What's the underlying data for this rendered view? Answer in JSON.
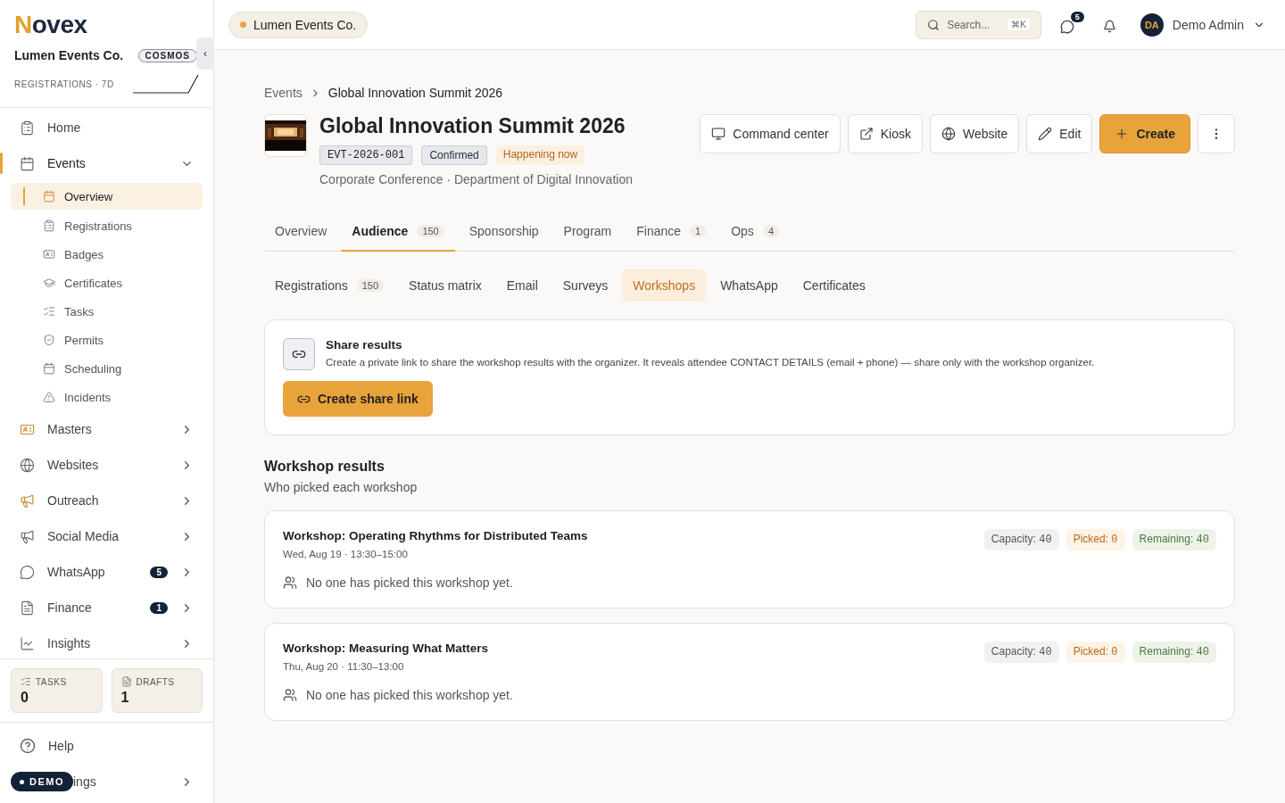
{
  "sidebar": {
    "logo_initial": "N",
    "logo_rest": "ovex",
    "org_name": "Lumen Events Co.",
    "plan_badge": "COSMOS",
    "collapse_glyph": "‹",
    "sparkline_label": "REGISTRATIONS · 7D",
    "items": [
      {
        "label": "Home",
        "selected": false
      },
      {
        "label": "Events",
        "selected": true,
        "expanded": true,
        "children": [
          {
            "label": "Overview",
            "selected": true
          },
          {
            "label": "Registrations",
            "selected": false
          },
          {
            "label": "Badges",
            "selected": false
          },
          {
            "label": "Certificates",
            "selected": false
          },
          {
            "label": "Tasks",
            "selected": false
          },
          {
            "label": "Permits",
            "selected": false
          },
          {
            "label": "Scheduling",
            "selected": false
          },
          {
            "label": "Incidents",
            "selected": false
          }
        ]
      },
      {
        "label": "Masters",
        "selected": false,
        "expanded": false
      },
      {
        "label": "Websites",
        "selected": false,
        "expanded": false
      },
      {
        "label": "Outreach",
        "selected": false,
        "expanded": false
      },
      {
        "label": "Social Media",
        "selected": false,
        "expanded": false
      },
      {
        "label": "WhatsApp",
        "selected": false,
        "expanded": false,
        "count": "5"
      },
      {
        "label": "Finance",
        "selected": false,
        "expanded": false,
        "count": "1"
      },
      {
        "label": "Insights",
        "selected": false,
        "expanded": false
      }
    ],
    "stats": [
      {
        "label": "TASKS",
        "value": "0"
      },
      {
        "label": "DRAFTS",
        "value": "1"
      }
    ],
    "help": "Help",
    "settings_visible": "ings",
    "demo_badge": "DEMO"
  },
  "topbar": {
    "org_chip": "Lumen Events Co.",
    "search_placeholder": "Search...",
    "search_shortcut": "⌘K",
    "messages_count": "5",
    "user_initials": "DA",
    "user_name": "Demo Admin"
  },
  "breadcrumb": [
    "Events",
    "Global Innovation Summit 2026"
  ],
  "event": {
    "title": "Global Innovation Summit 2026",
    "code": "EVT-2026-001",
    "status": "Confirmed",
    "live": "Happening now",
    "subtitle": "Corporate Conference · Department of Digital Innovation",
    "actions": [
      {
        "label": "Command center",
        "kind": "outline"
      },
      {
        "label": "Kiosk",
        "kind": "outline"
      },
      {
        "label": "Website",
        "kind": "outline"
      },
      {
        "label": "Edit",
        "kind": "outline"
      },
      {
        "label": "Create",
        "kind": "primary"
      },
      {
        "kind": "more"
      }
    ]
  },
  "tabs": [
    {
      "label": "Overview",
      "selected": false
    },
    {
      "label": "Audience",
      "count": "150",
      "selected": true
    },
    {
      "label": "Sponsorship",
      "selected": false
    },
    {
      "label": "Program",
      "selected": false
    },
    {
      "label": "Finance",
      "count": "1",
      "selected": false
    },
    {
      "label": "Ops",
      "count": "4",
      "selected": false
    }
  ],
  "subtabs": [
    {
      "label": "Registrations",
      "count": "150",
      "selected": false
    },
    {
      "label": "Status matrix",
      "selected": false
    },
    {
      "label": "Email",
      "selected": false
    },
    {
      "label": "Surveys",
      "selected": false
    },
    {
      "label": "Workshops",
      "selected": true
    },
    {
      "label": "WhatsApp",
      "selected": false
    },
    {
      "label": "Certificates",
      "selected": false
    }
  ],
  "share": {
    "title": "Share results",
    "description": "Create a private link to share the workshop results with the organizer. It reveals attendee CONTACT DETAILS (email + phone) — share only with the workshop organizer.",
    "button": "Create share link"
  },
  "results": {
    "title": "Workshop results",
    "subtitle": "Who picked each workshop",
    "workshops": [
      {
        "title": "Workshop: Operating Rhythms for Distributed Teams",
        "when": "Wed, Aug 19 · 13:30–15:00",
        "capacity_label": "Capacity:",
        "capacity": "40",
        "picked_label": "Picked:",
        "picked": "0",
        "remaining_label": "Remaining:",
        "remaining": "40",
        "empty": "No one has picked this workshop yet."
      },
      {
        "title": "Workshop: Measuring What Matters",
        "when": "Thu, Aug 20 · 11:30–13:00",
        "capacity_label": "Capacity:",
        "capacity": "40",
        "picked_label": "Picked:",
        "picked": "0",
        "remaining_label": "Remaining:",
        "remaining": "40",
        "empty": "No one has picked this workshop yet."
      }
    ]
  }
}
